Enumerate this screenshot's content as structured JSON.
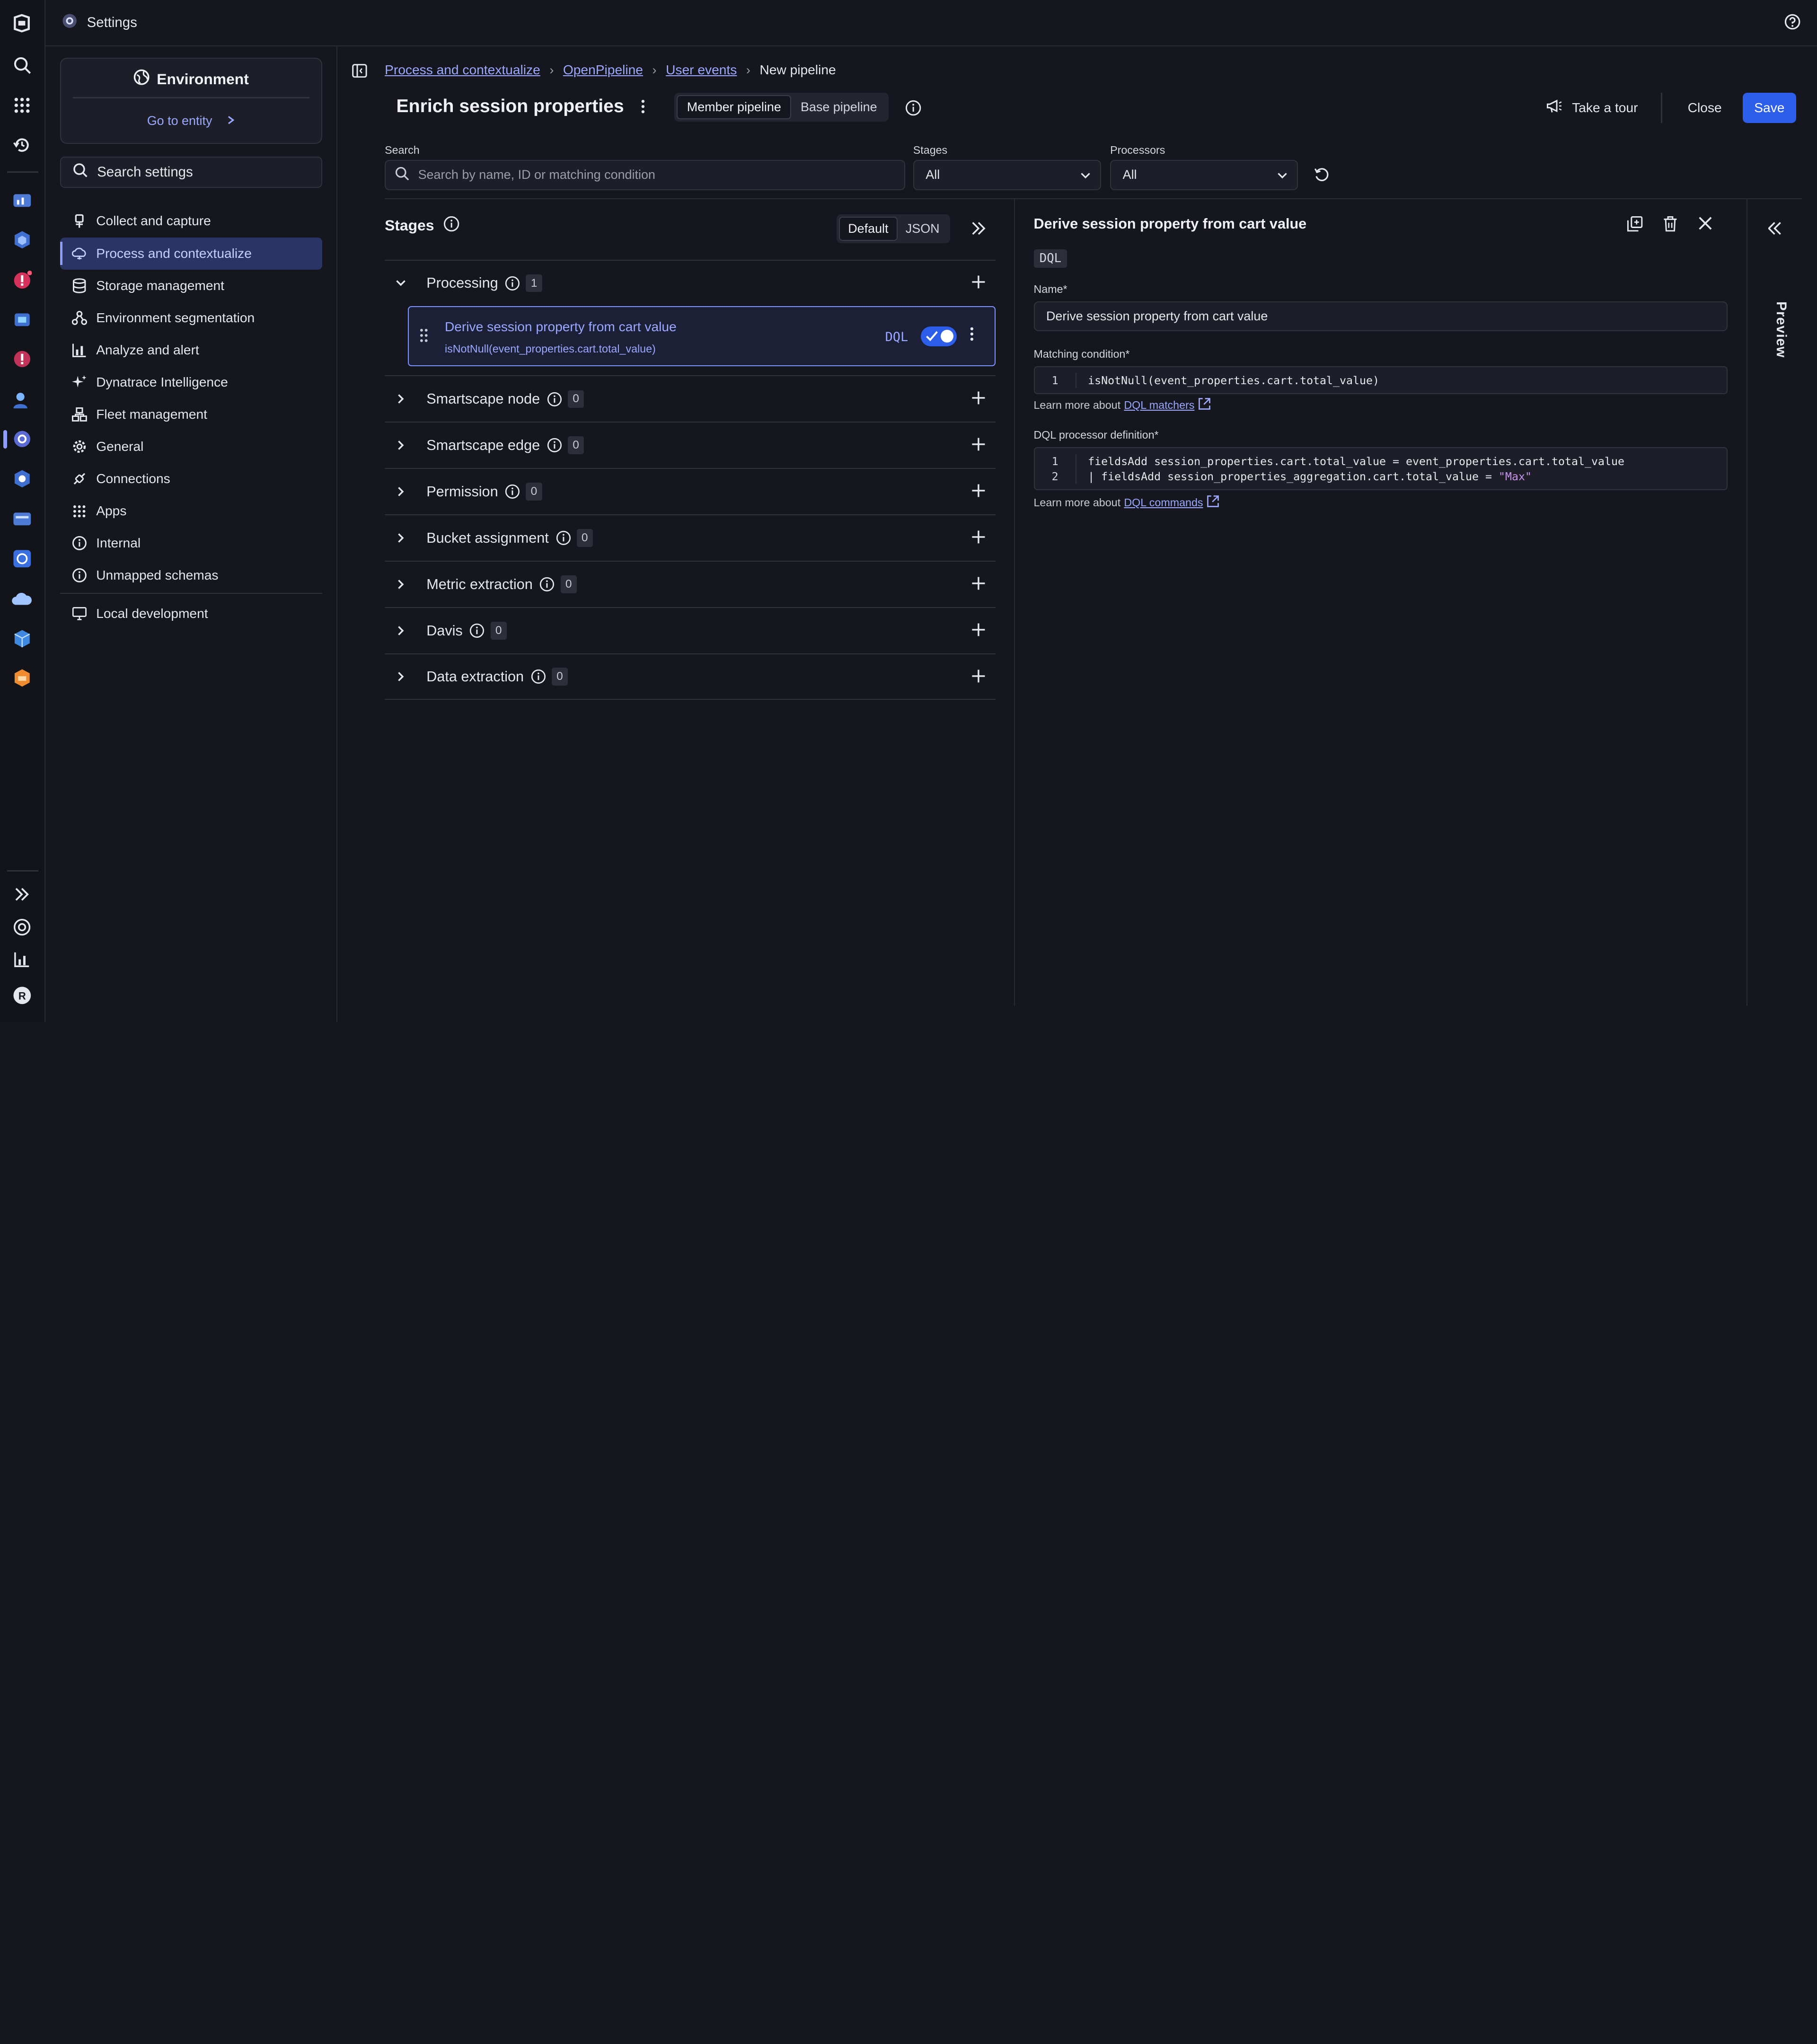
{
  "topbar": {
    "title": "Settings"
  },
  "sidebar": {
    "env_title": "Environment",
    "go_to_entity": "Go to entity",
    "search_label": "Search settings",
    "items": [
      {
        "label": "Collect and capture",
        "icon": "plug-icon"
      },
      {
        "label": "Process and contextualize",
        "icon": "cloud-process-icon",
        "active": true
      },
      {
        "label": "Storage management",
        "icon": "database-icon"
      },
      {
        "label": "Environment segmentation",
        "icon": "segmentation-icon"
      },
      {
        "label": "Analyze and alert",
        "icon": "chart-icon"
      },
      {
        "label": "Dynatrace Intelligence",
        "icon": "sparkle-icon"
      },
      {
        "label": "Fleet management",
        "icon": "fleet-icon"
      },
      {
        "label": "General",
        "icon": "gear-icon"
      },
      {
        "label": "Connections",
        "icon": "connection-icon"
      },
      {
        "label": "Apps",
        "icon": "apps-grid-icon"
      },
      {
        "label": "Internal",
        "icon": "info-icon"
      },
      {
        "label": "Unmapped schemas",
        "icon": "info-icon"
      },
      {
        "label": "Local development",
        "icon": "monitor-icon"
      }
    ]
  },
  "breadcrumb": {
    "items": [
      "Process and contextualize",
      "OpenPipeline",
      "User events"
    ],
    "current": "New pipeline"
  },
  "header": {
    "title": "Enrich session properties",
    "member_pipeline": "Member pipeline",
    "base_pipeline": "Base pipeline",
    "take_tour": "Take a tour",
    "close": "Close",
    "save": "Save"
  },
  "filters": {
    "search_label": "Search",
    "search_placeholder": "Search by name, ID or matching condition",
    "stages_label": "Stages",
    "stages_value": "All",
    "processors_label": "Processors",
    "processors_value": "All"
  },
  "stages": {
    "title": "Stages",
    "view_default": "Default",
    "view_json": "JSON",
    "list": [
      {
        "name": "Processing",
        "count": "1",
        "expanded": true
      },
      {
        "name": "Smartscape node",
        "count": "0"
      },
      {
        "name": "Smartscape edge",
        "count": "0"
      },
      {
        "name": "Permission",
        "count": "0"
      },
      {
        "name": "Bucket assignment",
        "count": "0"
      },
      {
        "name": "Metric extraction",
        "count": "0"
      },
      {
        "name": "Davis",
        "count": "0"
      },
      {
        "name": "Data extraction",
        "count": "0"
      }
    ],
    "processor": {
      "name": "Derive session property from cart value",
      "condition": "isNotNull(event_properties.cart.total_value)",
      "tag": "DQL",
      "enabled": true
    }
  },
  "details": {
    "title": "Derive session property from cart value",
    "tag": "DQL",
    "name_label": "Name*",
    "name_value": "Derive session property from cart value",
    "matching_label": "Matching condition*",
    "matching_lines": [
      {
        "n": "1",
        "code": "isNotNull(event_properties.cart.total_value)"
      }
    ],
    "learn_prefix": "Learn more about",
    "learn_matchers": "DQL matchers",
    "dql_label": "DQL processor definition*",
    "dql_lines": [
      {
        "n": "1",
        "code": "fieldsAdd session_properties.cart.total_value = event_properties.cart.total_value"
      },
      {
        "n": "2",
        "code": "| fieldsAdd session_properties_aggregation.cart.total_value = ",
        "str": "\"Max\""
      }
    ],
    "learn_commands": "DQL commands"
  },
  "preview": {
    "label": "Preview"
  },
  "colors": {
    "accent": "#2c5ee9",
    "link": "#9aa8ff",
    "bg": "#15161e"
  }
}
